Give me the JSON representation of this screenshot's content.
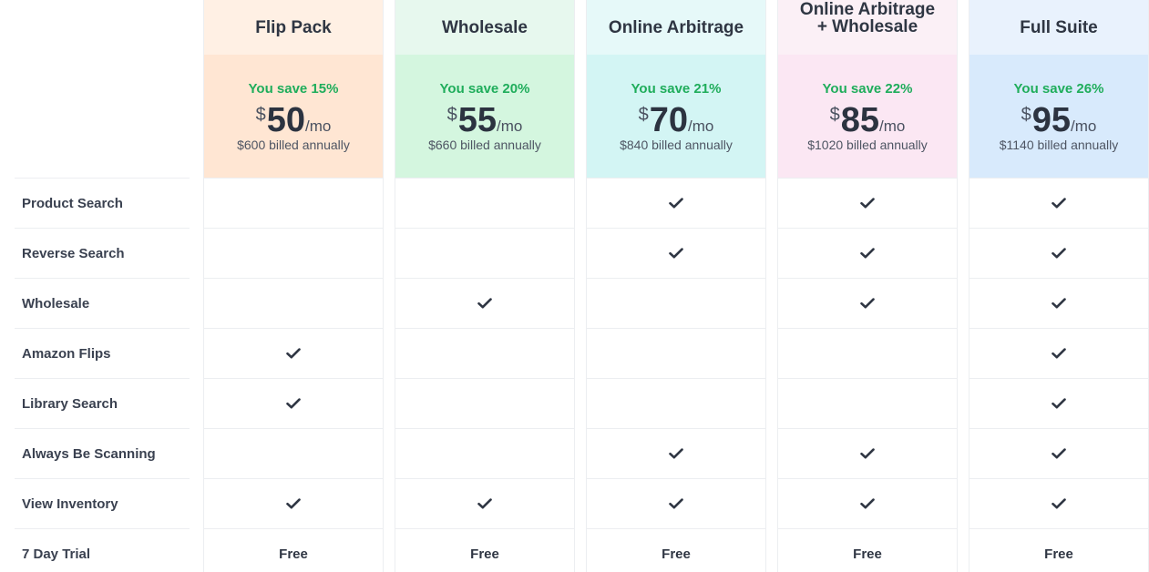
{
  "features": [
    "Product Search",
    "Reverse Search",
    "Wholesale",
    "Amazon Flips",
    "Library Search",
    "Always Be Scanning",
    "View Inventory",
    "7 Day Trial"
  ],
  "plans": [
    {
      "name": "Flip Pack",
      "save": "You save 15%",
      "currency": "$",
      "amount": "50",
      "per": "/mo",
      "billed": "$600 billed annually",
      "header_color": "#fff0e4",
      "price_color": "#ffe6d3",
      "features": [
        false,
        false,
        false,
        true,
        true,
        false,
        true
      ],
      "trial": "Free"
    },
    {
      "name": "Wholesale",
      "save": "You save 20%",
      "currency": "$",
      "amount": "55",
      "per": "/mo",
      "billed": "$660 billed annually",
      "header_color": "#e7f8ee",
      "price_color": "#d4f6df",
      "features": [
        false,
        false,
        true,
        false,
        false,
        false,
        true
      ],
      "trial": "Free"
    },
    {
      "name": "Online Arbitrage",
      "save": "You save 21%",
      "currency": "$",
      "amount": "70",
      "per": "/mo",
      "billed": "$840 billed annually",
      "header_color": "#e6f9f9",
      "price_color": "#d3f5f4",
      "features": [
        true,
        true,
        false,
        false,
        false,
        true,
        true
      ],
      "trial": "Free"
    },
    {
      "name_line1": "Online Arbitrage",
      "name_line2": "+ Wholesale",
      "save": "You save 22%",
      "currency": "$",
      "amount": "85",
      "per": "/mo",
      "billed": "$1020 billed annually",
      "header_color": "#fbf0f6",
      "price_color": "#fbe7f3",
      "features": [
        true,
        true,
        true,
        false,
        false,
        true,
        true
      ],
      "trial": "Free"
    },
    {
      "name": "Full Suite",
      "save": "You save 26%",
      "currency": "$",
      "amount": "95",
      "per": "/mo",
      "billed": "$1140 billed annually",
      "header_color": "#e9f2fd",
      "price_color": "#d8eafc",
      "features": [
        true,
        true,
        true,
        true,
        true,
        true,
        true
      ],
      "trial": "Free"
    }
  ]
}
